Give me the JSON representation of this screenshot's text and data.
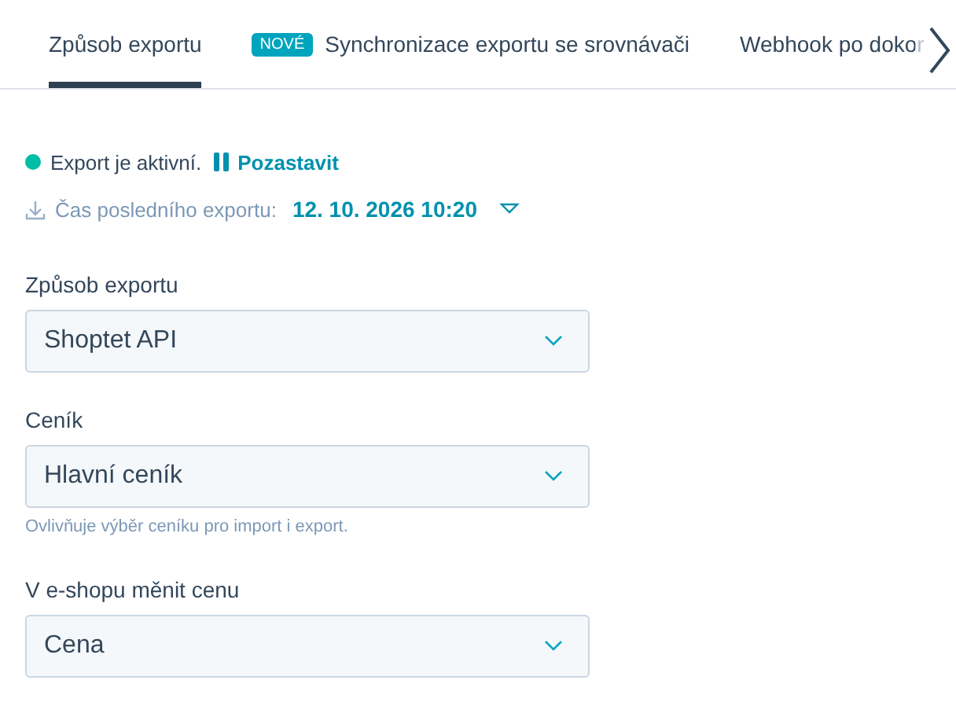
{
  "tabs": [
    {
      "label": "Způsob exportu",
      "selected": true
    },
    {
      "label": "Synchronizace exportu se srovnávači",
      "badge": "NOVÉ",
      "selected": false
    },
    {
      "label": "Webhook po dokor",
      "selected": false
    }
  ],
  "status": {
    "text": "Export je aktivní.",
    "active": true,
    "action": "Pozastavit"
  },
  "last_export": {
    "label": "Čas posledního exportu:",
    "value": "12. 10. 2026 10:20"
  },
  "fields": [
    {
      "label": "Způsob exportu",
      "value": "Shoptet API"
    },
    {
      "label": "Ceník",
      "value": "Hlavní ceník",
      "help": "Ovlivňuje výběr ceníku pro import i export."
    },
    {
      "label": "V e-shopu měnit cenu",
      "value": "Cena"
    }
  ]
}
